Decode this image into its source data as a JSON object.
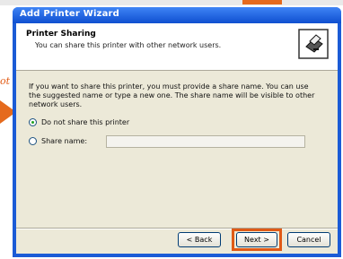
{
  "window": {
    "title": "Add Printer Wizard"
  },
  "header": {
    "title": "Printer Sharing",
    "subtitle": "You can share this printer with other network users."
  },
  "body": {
    "instructions": "If you want to share this printer, you must provide a share name. You can use the suggested name or type a new one. The share name will be visible to other network users."
  },
  "options": {
    "do_not_share": {
      "label": "Do not share this printer",
      "selected": true
    },
    "share_name": {
      "label": "Share name:",
      "selected": false,
      "value": ""
    }
  },
  "buttons": {
    "back": "< Back",
    "next": "Next >",
    "cancel": "Cancel"
  },
  "annotation": {
    "fragment_text": "ot"
  },
  "colors": {
    "annotation_accent": "#e05a16",
    "titlebar_blue": "#1b5bd6",
    "dialog_face": "#ece9d8"
  },
  "icons": {
    "header_icon": "printer-icon",
    "pointer": "orange-arrow-icon"
  }
}
